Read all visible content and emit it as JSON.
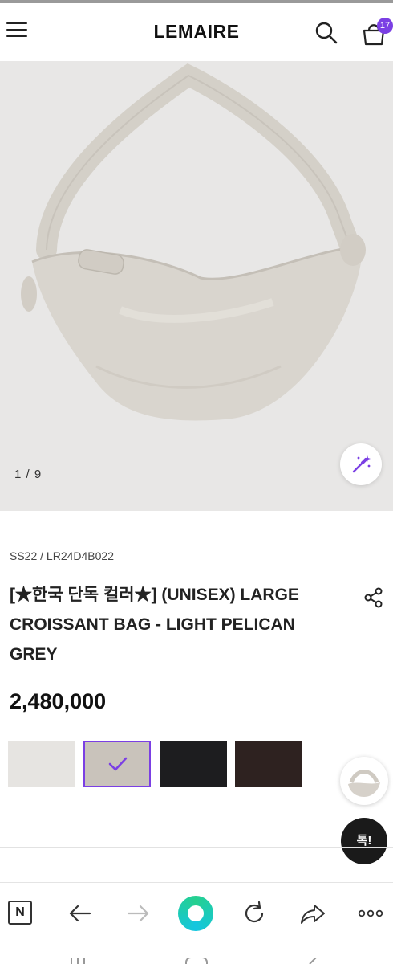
{
  "header": {
    "brand": "LEMAIRE",
    "cart_count": "17"
  },
  "gallery": {
    "counter": "1 / 9"
  },
  "product": {
    "code": "SS22 / LR24D4B022",
    "title": "[★한국 단독 컬러★] (UNISEX) LARGE CROISSANT BAG - LIGHT PELICAN GREY",
    "price": "2,480,000"
  },
  "swatches": [
    {
      "name": "light",
      "color": "#e6e4e1"
    },
    {
      "name": "light pelican grey",
      "color": "#c9c3bb",
      "selected": true
    },
    {
      "name": "black",
      "color": "#1d1d1f"
    },
    {
      "name": "dark brown",
      "color": "#2e2220"
    }
  ],
  "talk_button": "톡!",
  "bottom_bar": {
    "n_label": "N"
  },
  "colors": {
    "accent": "#7b3fe4",
    "green": "#25d08f"
  }
}
